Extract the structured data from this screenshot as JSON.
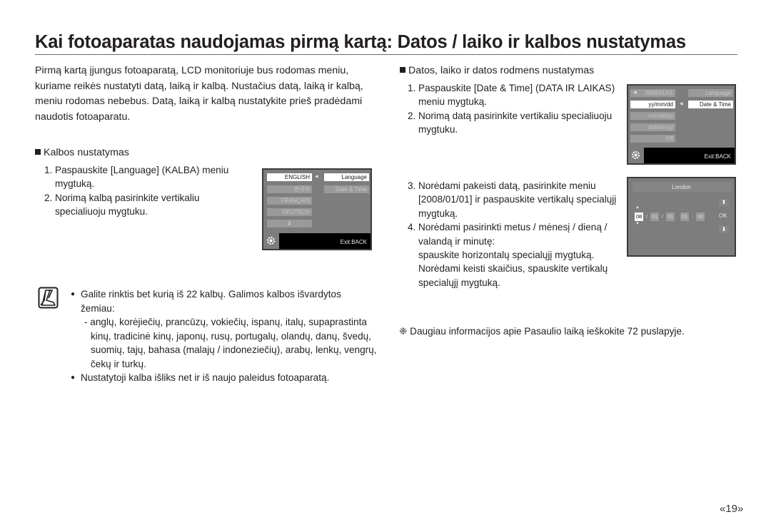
{
  "title": "Kai fotoaparatas naudojamas pirmą kartą: Datos / laiko ir kalbos nustatymas",
  "intro": "Pirmą kartą įjungus fotoaparatą, LCD monitoriuje bus rodomas meniu, kuriame reikės nustatyti datą, laiką ir kalbą. Nustačius datą, laiką ir kalbą, meniu rodomas nebebus. Datą, laiką ir kalbą nustatykite prieš pradėdami naudotis fotoaparatu.",
  "language_section": {
    "heading": "Kalbos nustatymas",
    "steps": [
      {
        "num": "1.",
        "lines": [
          "Paspauskite [Language] (KALBA) meniu",
          "mygtuką."
        ]
      },
      {
        "num": "2.",
        "lines": [
          "Norimą kalbą pasirinkite vertikaliu",
          "specialiuoju mygtuku."
        ]
      }
    ],
    "lcd": {
      "left_items": [
        "ENGLISH",
        "한국어",
        "FRANÇAIS",
        "DEUTSCH",
        "⬇"
      ],
      "right_items": [
        "Language",
        "Date & Time"
      ],
      "exit_label": "Exit:BACK"
    }
  },
  "date_section": {
    "heading": "Datos, laiko ir datos rodmens nustatymas",
    "steps_a": [
      {
        "num": "1.",
        "lines": [
          "Paspauskite [Date & Time] (DATA IR LAIKAS)",
          "meniu mygtuką."
        ]
      },
      {
        "num": "2.",
        "lines": [
          "Norimą datą pasirinkite vertikaliu specialiuoju",
          "mygtuku."
        ]
      }
    ],
    "steps_b": [
      {
        "num": "3.",
        "lines": [
          "Norėdami pakeisti datą, pasirinkite meniu",
          "[2008/01/01] ir paspauskite vertikalų specialųjį",
          "mygtuką."
        ]
      },
      {
        "num": "4.",
        "lines": [
          "Norėdami pasirinkti metus / mėnesį / dieną /",
          "valandą ir minutę:",
          "spauskite horizontalų specialųjį mygtuką.",
          "Norėdami keisti skaičius, spauskite vertikalų",
          "specialųjį mygtuką."
        ]
      }
    ],
    "lcd_menu": {
      "left_items": [
        "2008/01/01",
        "yy/mm/dd",
        "mm/dd/yy",
        "dd/mm/yy",
        "Off"
      ],
      "right_items": [
        "Language",
        "Date & Time"
      ],
      "exit_label": "Exit:BACK"
    },
    "lcd_edit": {
      "city": "London",
      "fields": [
        "08",
        "01",
        "01",
        "01",
        "00"
      ],
      "separators": [
        "/",
        "/",
        "",
        ":"
      ],
      "ok_label": "OK",
      "up_arrow": "⬆",
      "down_arrow": "⬇"
    }
  },
  "notes": {
    "items": [
      {
        "text": "Galite rinktis bet kurią iš 22 kalbų. Galimos kalbos išvardytos žemiau:",
        "sub": "- anglų, korėjiečių, prancūzų, vokiečių, ispanų, italų, supaprastinta kinų, tradicinė kinų, japonų, rusų, portugalų, olandų, danų, švedų, suomių, tajų, bahasa (malajų / indoneziečių), arabų, lenkų, vengrų, čekų ir turkų."
      },
      {
        "text": "Nustatytoji kalba išliks net ir iš naujo paleidus fotoaparatą.",
        "sub": ""
      }
    ],
    "bullet": "●"
  },
  "footnote": "❈ Daugiau informacijos apie Pasaulio laiką ieškokite 72 puslapyje.",
  "page_number": "«19»"
}
